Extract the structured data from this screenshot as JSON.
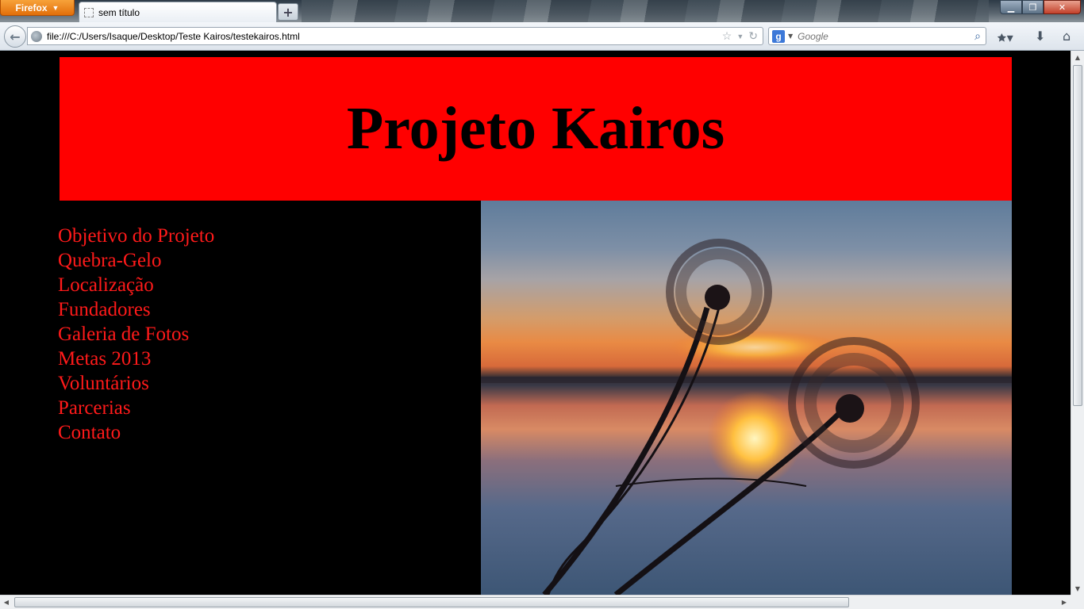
{
  "browser": {
    "app_button": "Firefox",
    "tab_title": "sem título",
    "new_tab_label": "+",
    "url": "file:///C:/Users/Isaque/Desktop/Teste Kairos/testekairos.html",
    "search_engine": "Google",
    "search_placeholder": "Google"
  },
  "page": {
    "banner_title": "Projeto Kairos",
    "banner_color": "#ff0000",
    "background_color": "#000000",
    "link_color": "#ff1a1a",
    "nav_links": [
      "Objetivo do Projeto",
      "Quebra-Gelo",
      "Localização",
      "Fundadores",
      "Galeria de Fotos",
      "Metas 2013",
      "Voluntários",
      "Parcerias",
      "Contato"
    ]
  }
}
